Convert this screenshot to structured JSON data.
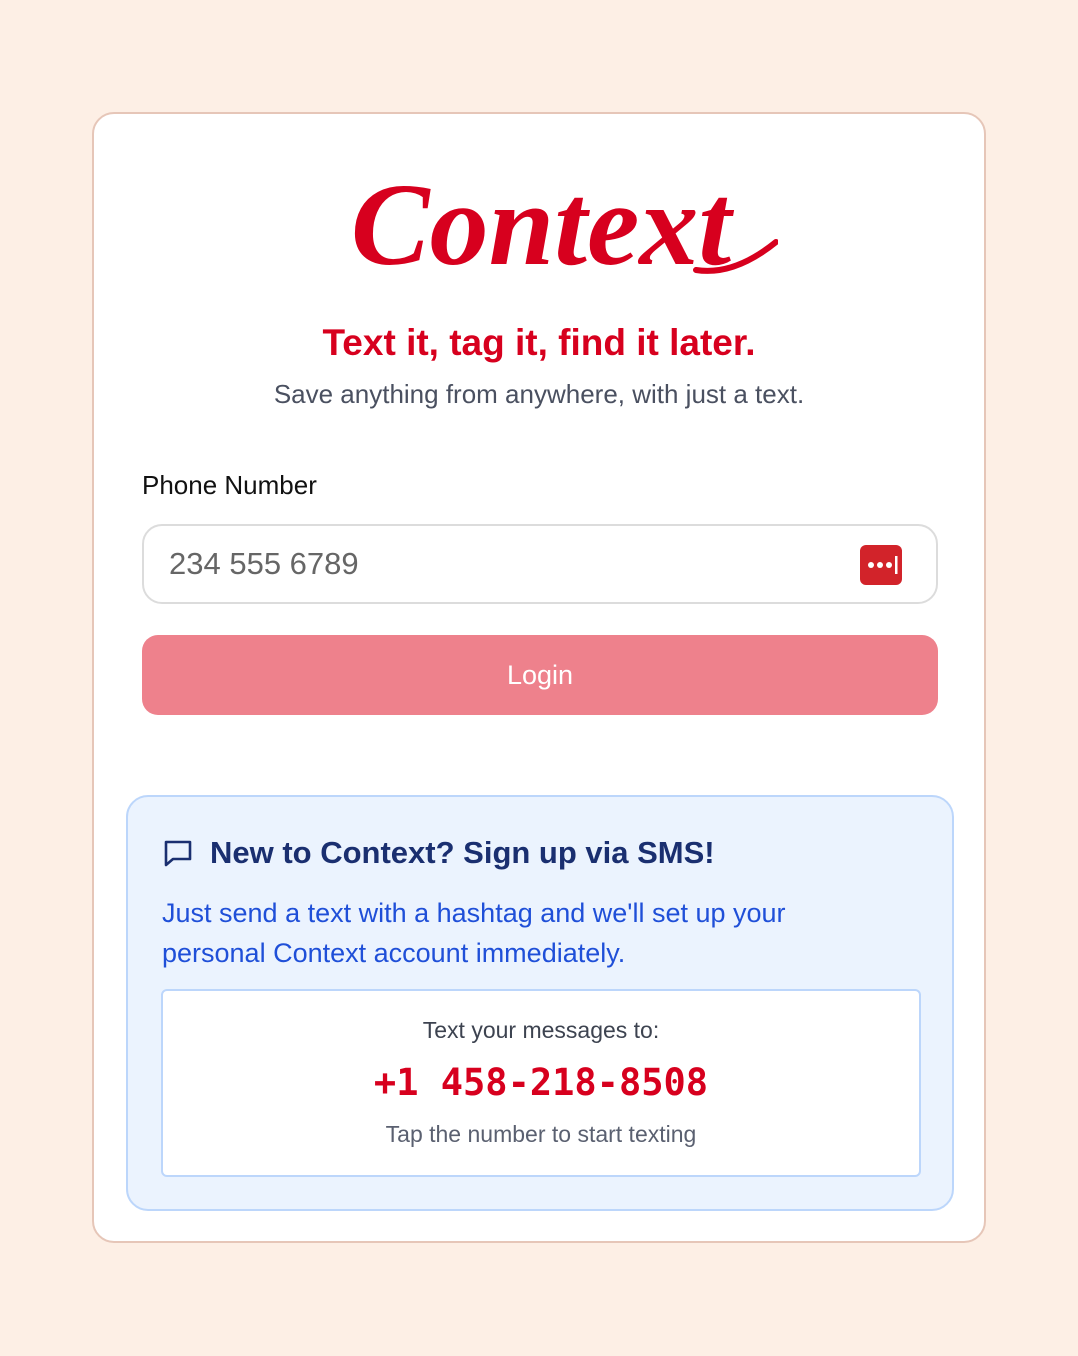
{
  "brand": {
    "logo_text": "Context",
    "color": "#d7001e"
  },
  "hero": {
    "tagline": "Text it, tag it, find it later.",
    "subtitle": "Save anything from anywhere, with just a text."
  },
  "login_form": {
    "phone_label": "Phone Number",
    "phone_placeholder": "234 555 6789",
    "phone_value": "",
    "password_manager_icon": "password-dots-icon",
    "login_label": "Login",
    "login_color": "#ee818c"
  },
  "signup": {
    "icon": "chat-bubble-icon",
    "title": "New to Context? Sign up via SMS!",
    "description": "Just send a text with a hashtag and we'll set up your personal Context account immediately.",
    "number_caption": "Text your messages to:",
    "sms_number": "+1 458-218-8508",
    "number_hint": "Tap the number to start texting"
  }
}
